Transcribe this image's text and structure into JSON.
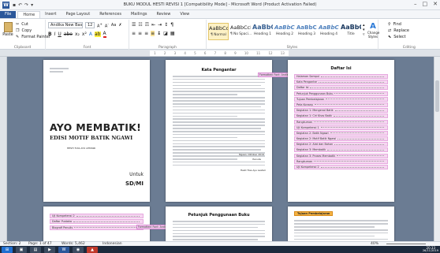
{
  "window": {
    "title": "BUKU MODUL HESTI REVISI 1 [Compatibility Mode] - Microsoft Word (Product Activation Failed)"
  },
  "tabs": [
    "File",
    "Home",
    "Insert",
    "Page Layout",
    "References",
    "Mailings",
    "Review",
    "View"
  ],
  "clipboard": {
    "paste": "Paste",
    "cut": "Cut",
    "copy": "Copy",
    "format_painter": "Format Painter",
    "label": "Clipboard"
  },
  "font": {
    "name": "Andika New Bas",
    "size": "12",
    "label": "Font"
  },
  "paragraph": {
    "label": "Paragraph"
  },
  "styles": {
    "items": [
      {
        "preview": "AaBbCcDc",
        "name": "¶ Normal",
        "selected": true
      },
      {
        "preview": "AaBbCcDc",
        "name": "¶ No Spaci..."
      },
      {
        "preview": "AaBbC",
        "name": "Heading 1"
      },
      {
        "preview": "AaBbCc",
        "name": "Heading 2"
      },
      {
        "preview": "AaBbCc",
        "name": "Heading 3"
      },
      {
        "preview": "AaBbCc",
        "name": "Heading 4"
      },
      {
        "preview": "AaBbC",
        "name": "Title"
      }
    ],
    "change_styles": "Change Styles",
    "label": "Styles"
  },
  "editing": {
    "find": "Find",
    "replace": "Replace",
    "select": "Select",
    "label": "Editing"
  },
  "ruler": {
    "marks": [
      "1",
      "2",
      "3",
      "4",
      "5",
      "6",
      "7",
      "8",
      "9",
      "10",
      "11",
      "12",
      "13"
    ]
  },
  "pages": {
    "cover": {
      "title": "AYO MEMBATIK!",
      "subtitle": "EDISI MOTIF BATIK NGAWI",
      "author": "HESTI TIAS AYU LESTARI",
      "for": "Untuk",
      "level": "SD/MI"
    },
    "preface": {
      "title": "Kata Pengantar",
      "sign_place": "Ngawi, Oktober 2019",
      "sign_role": "Penulis",
      "sign_name": "Hesti Tias Ayu Lestari"
    },
    "toc": {
      "title": "Daftar Isi",
      "items": [
        "Halaman Sampul",
        "Kata Pengantar",
        "Daftar Isi",
        "Petunjuk Penggunaan Buku",
        "Tujuan Pembelajaran",
        "Peta Konsep",
        "Kegiatan 1: Mengenal Batik",
        "Kegiatan 1: Ciri Khas Batik",
        "Rangkuman",
        "Uji Kompetensi 1",
        "Kegiatan 2: Batik Ngawi",
        "Kegiatan 2: Motif Batik Ngawi",
        "Kegiatan 2: Alat dan Bahan",
        "Kegiatan 3: Membatik",
        "Kegiatan 3: Proses Membatik",
        "Rangkuman",
        "Uji Kompetensi 2"
      ]
    },
    "p4": {
      "items": [
        "Uji Kompetensi 2",
        "Daftar Pustaka",
        "Biografi Penulis"
      ]
    },
    "guide": {
      "title": "Petunjuk Penggunaan Buku"
    },
    "goal": {
      "title": "Tujuan Pembelajaran"
    }
  },
  "comments": {
    "c1": "Formatted: Font: Andika",
    "c2": "Formatted: Font: Andika"
  },
  "status": {
    "section": "Section: 2",
    "page": "Page: 1 of 47",
    "words": "Words: 5,462",
    "language": "Indonesian",
    "zoom": "40%"
  },
  "taskbar": {
    "time": "20.33",
    "date": "26/11/2019"
  },
  "colors": {
    "word_blue": "#2b579a",
    "highlight": "#f5d6f0",
    "canvas": "#6b7c93"
  }
}
